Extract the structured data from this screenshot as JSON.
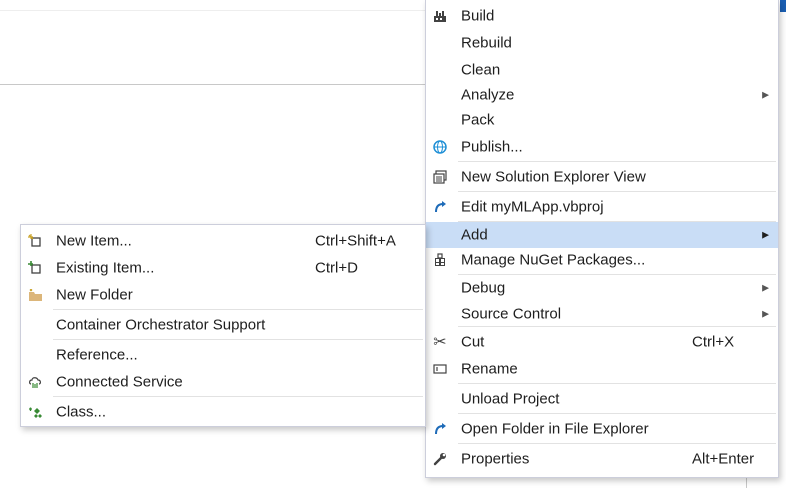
{
  "main_menu": {
    "build": "Build",
    "rebuild": "Rebuild",
    "clean": "Clean",
    "analyze": "Analyze",
    "pack": "Pack",
    "publish": "Publish...",
    "new_solution_explorer_view": "New Solution Explorer View",
    "edit_project": "Edit myMLApp.vbproj",
    "add": "Add",
    "manage_nuget": "Manage NuGet Packages...",
    "debug": "Debug",
    "source_control": "Source Control",
    "cut": "Cut",
    "cut_shortcut": "Ctrl+X",
    "rename": "Rename",
    "unload_project": "Unload Project",
    "open_folder": "Open Folder in File Explorer",
    "properties": "Properties",
    "properties_shortcut": "Alt+Enter"
  },
  "add_submenu": {
    "new_item": "New Item...",
    "new_item_shortcut": "Ctrl+Shift+A",
    "existing_item": "Existing Item...",
    "existing_item_shortcut": "Ctrl+D",
    "new_folder": "New Folder",
    "container_orchestrator": "Container Orchestrator Support",
    "reference": "Reference...",
    "connected_service": "Connected Service",
    "class": "Class..."
  },
  "colors": {
    "highlight": "#c9ddf6",
    "accent_blue": "#1e6bb8",
    "menu_border": "#cccedb"
  },
  "icons": {
    "build": "build-icon",
    "publish": "globe-icon",
    "new_view": "window-icon",
    "edit": "curved-arrow-icon",
    "nuget": "package-icon",
    "cut": "scissors-icon",
    "rename": "rename-icon",
    "open_folder": "curved-arrow-icon",
    "properties": "wrench-icon",
    "new_item": "new-item-icon",
    "existing_item": "existing-item-icon",
    "new_folder": "folder-icon",
    "connected_service": "connected-service-icon",
    "class": "class-icon"
  }
}
